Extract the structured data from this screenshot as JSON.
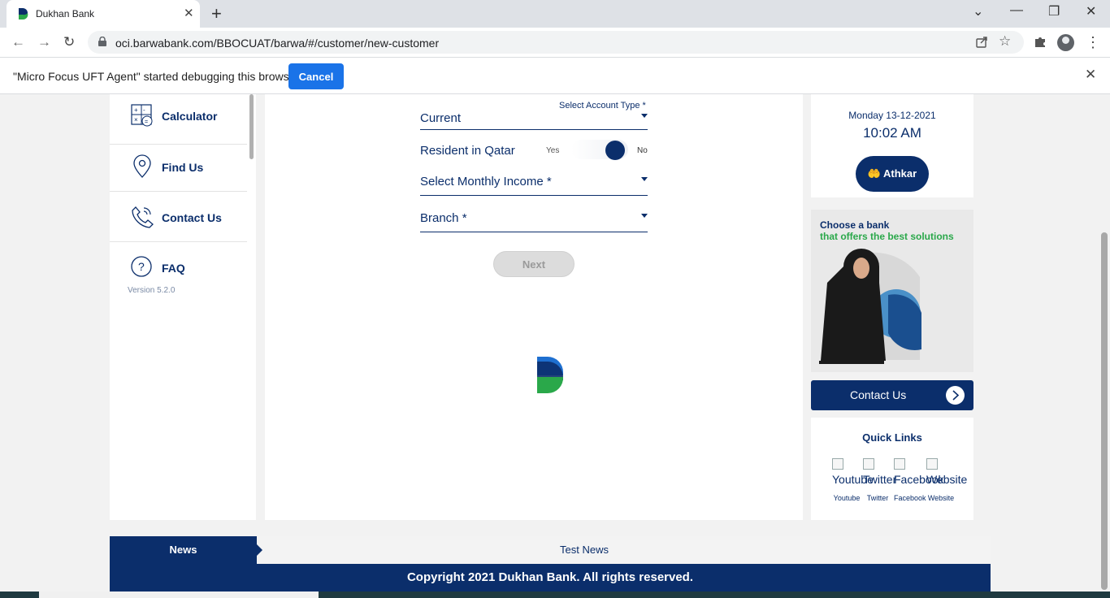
{
  "browser": {
    "tab_title": "Dukhan Bank",
    "url": "oci.barwabank.com/BBOCUAT/barwa/#/customer/new-customer",
    "infobar_message": "\"Micro Focus UFT Agent\" started debugging this browser",
    "infobar_cancel": "Cancel"
  },
  "sidebar": {
    "items": [
      {
        "label": "Calculator",
        "icon": "calculator-icon"
      },
      {
        "label": "Find Us",
        "icon": "location-pin-icon"
      },
      {
        "label": "Contact Us",
        "icon": "phone-icon"
      },
      {
        "label": "FAQ",
        "icon": "question-icon"
      }
    ],
    "version": "Version 5.2.0"
  },
  "form": {
    "account_type_label": "Select Account Type *",
    "account_type_value": "Current",
    "resident_label": "Resident in Qatar",
    "resident_yes": "Yes",
    "resident_no": "No",
    "monthly_income_placeholder": "Select Monthly Income *",
    "branch_placeholder": "Branch *",
    "next_label": "Next"
  },
  "right": {
    "date": "Monday 13-12-2021",
    "time": "10:02 AM",
    "athkar_label": "Athkar",
    "ad_line1": "Choose a bank",
    "ad_line2": "that offers the best solutions",
    "contact_label": "Contact Us",
    "quick_links_title": "Quick Links",
    "quick_links": [
      {
        "alt": "Youtube",
        "caption": "Youtube"
      },
      {
        "alt": "Twitter",
        "caption": "Twitter"
      },
      {
        "alt": "Facebook",
        "caption": "Facebook"
      },
      {
        "alt": "Website",
        "caption": "Website"
      }
    ]
  },
  "news": {
    "tag": "News",
    "text": "Test News"
  },
  "footer": {
    "copyright": "Copyright 2021 Dukhan Bank. All rights reserved."
  },
  "colors": {
    "brand_navy": "#0b2e6b",
    "brand_green": "#2aa84a",
    "chrome_blue": "#1a73e8"
  }
}
